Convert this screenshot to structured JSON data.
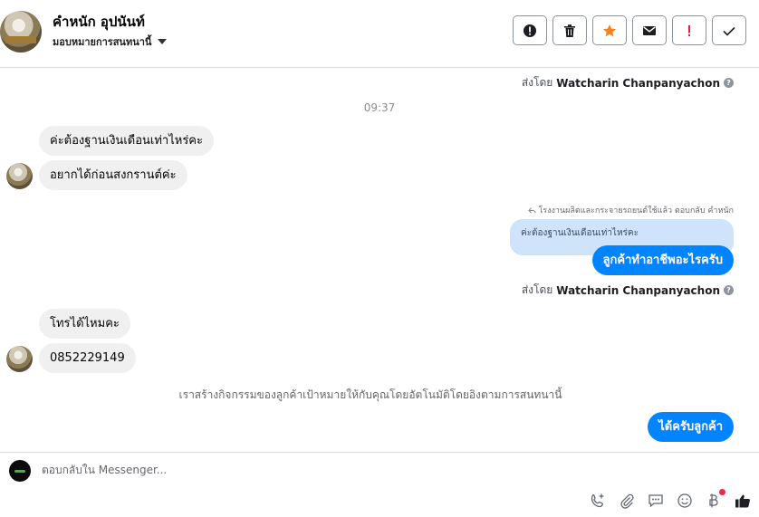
{
  "header": {
    "contact_name": "คำหนัก อุปนันท์",
    "assign_label": "มอบหมายการสนทนานี้",
    "actions": [
      {
        "icon": "alert-circle-icon",
        "color": "#1c1e21"
      },
      {
        "icon": "trash-icon",
        "color": "#1c1e21"
      },
      {
        "icon": "star-icon",
        "color": "#f5821f"
      },
      {
        "icon": "envelope-icon",
        "color": "#1c1e21"
      },
      {
        "icon": "exclamation-icon",
        "color": "#e41e3f"
      },
      {
        "icon": "check-icon",
        "color": "#1c1e21"
      }
    ]
  },
  "messages": {
    "sent_by_1": {
      "prefix": "ส่งโดย",
      "name": "Watcharin Chanpanyachon"
    },
    "timestamp": "09:37",
    "incoming_1": "ค่ะต้องฐานเงินเดือนเท่าไหร่คะ",
    "incoming_2": "อยากได้ก่อนสงกรานต์ค่ะ",
    "reply_meta": "โรงงานผลิตและกระจายรถยนต์ใช้แล้ว ตอบกลับ คำหนัก",
    "quoted_text": "ค่ะต้องฐานเงินเดือนเท่าไหร่คะ",
    "outgoing_1": "ลูกค้าทำอาชีพอะไรครับ",
    "sent_by_2": {
      "prefix": "ส่งโดย",
      "name": "Watcharin Chanpanyachon"
    },
    "incoming_3": "โทรได้ไหมคะ",
    "incoming_4": "0852229149",
    "system_message": "เราสร้างกิจกรรมของลูกค้าเป้าหมายให้กับคุณโดยอัตโนมัติโดยอิงตามการสนทนานี้",
    "outgoing_2": "ได้ครับลูกค้า"
  },
  "composer": {
    "placeholder": "ตอบกลับใน Messenger...",
    "tools": [
      "phone-add-icon",
      "paperclip-icon",
      "chat-bubble-icon",
      "smiley-icon",
      "baht-icon",
      "thumbs-up-icon"
    ]
  },
  "colors": {
    "accent_blue": "#0084ff",
    "quoted_bg": "#cfe3fb",
    "incoming_bg": "#f0f0f0",
    "star_orange": "#f5821f",
    "alert_red": "#e41e3f"
  }
}
